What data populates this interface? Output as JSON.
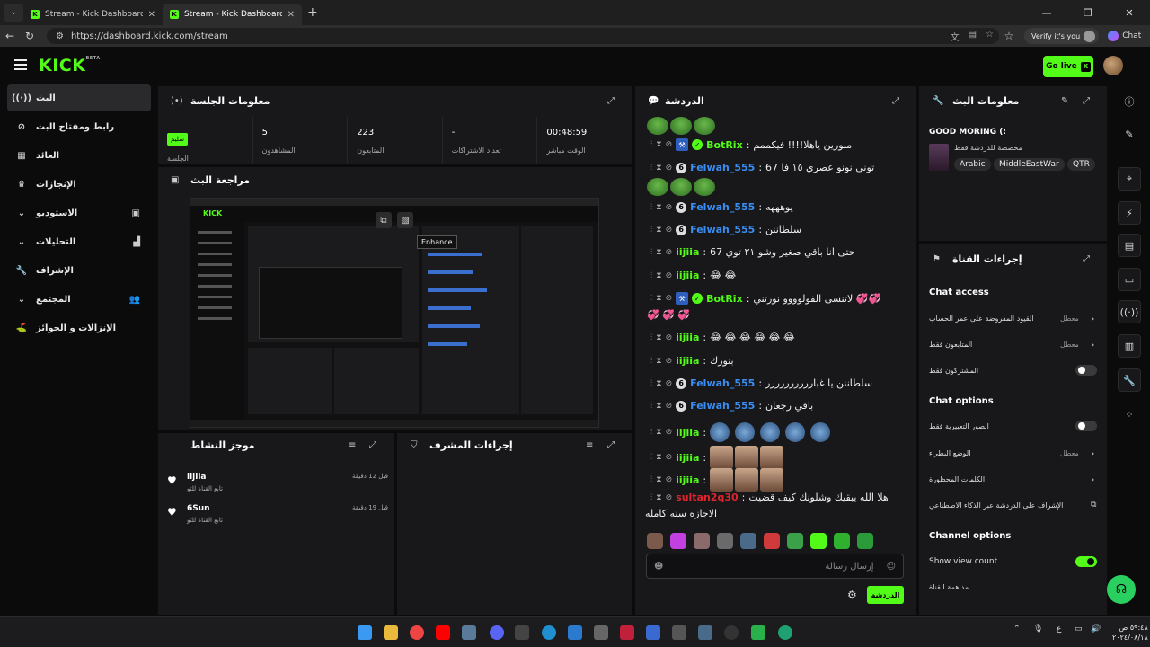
{
  "browser": {
    "tabs": [
      {
        "title": "Stream - Kick Dashboard"
      },
      {
        "title": "Stream - Kick Dashboard"
      }
    ],
    "url": "https://dashboard.kick.com/stream",
    "verify_label": "Verify it's you",
    "chat_label": "Chat"
  },
  "header": {
    "logo": "KICK",
    "logo_sup": "BETA",
    "go_live": "Go live"
  },
  "sidebar": {
    "items": [
      {
        "label": "البث",
        "icon": "broadcast-icon"
      },
      {
        "label": "رابط ومفتاح البث",
        "icon": "link-icon"
      },
      {
        "label": "العائد",
        "icon": "revenue-icon"
      },
      {
        "label": "الإنجازات",
        "icon": "trophy-icon"
      },
      {
        "label": "الاستوديو",
        "icon": "studio-icon"
      },
      {
        "label": "التحليلات",
        "icon": "analytics-icon"
      },
      {
        "label": "الإشراف",
        "icon": "wrench-icon"
      },
      {
        "label": "المجتمع",
        "icon": "community-icon"
      },
      {
        "label": "الإنزالات و الجوائز",
        "icon": "drops-icon"
      }
    ]
  },
  "session": {
    "title": "معلومات الجلسة",
    "badge": "سليم",
    "cells": [
      {
        "label": "الجلسة",
        "value": ""
      },
      {
        "label": "المشاهدون",
        "value": "5"
      },
      {
        "label": "المتابعون",
        "value": "223"
      },
      {
        "label": "تعداد الاشتراكات",
        "value": "-"
      },
      {
        "label": "الوقت مباشر",
        "value": "00:48:59"
      }
    ]
  },
  "preview": {
    "title": "مراجعة البث",
    "tooltip": "Enhance"
  },
  "activity": {
    "title": "موجز النشاط",
    "items": [
      {
        "name": "iijiia",
        "desc": "تابع القناة للتو",
        "time": "قبل 12 دقيقة"
      },
      {
        "name": "6Sun",
        "desc": "تابع القناة للتو",
        "time": "قبل 19 دقيقة"
      }
    ]
  },
  "moderator": {
    "title": "إجراءات المشرف"
  },
  "chat": {
    "title": "الدردشة",
    "messages": [
      {
        "user": "BotRix",
        "color": "#53fc18",
        "badge": "bot",
        "text": "منورين ياهلا!!!! فيكممم"
      },
      {
        "user": "Felwah_555",
        "color": "#3a8df2",
        "badge": "6",
        "text": "توني نونو عصري ١٥ فا 67"
      },
      {
        "user": "Felwah_555",
        "color": "#3a8df2",
        "badge": "6",
        "text": "يوهههه"
      },
      {
        "user": "Felwah_555",
        "color": "#3a8df2",
        "badge": "6",
        "text": "سلطاننن"
      },
      {
        "user": "iijiia",
        "color": "#53fc18",
        "badge": "",
        "text": "حتى انا باقي صغير وشو ٢١ توي 67"
      },
      {
        "user": "iijiia",
        "color": "#53fc18",
        "badge": "",
        "text": "😂 😂"
      },
      {
        "user": "BotRix",
        "color": "#53fc18",
        "badge": "bot",
        "text": "لاتنسى الفولوووو نورتني 💞💞"
      },
      {
        "user": "iijiia",
        "color": "#53fc18",
        "badge": "",
        "text": "😂 😂 😂 😂 😂 😂"
      },
      {
        "user": "iijiia",
        "color": "#53fc18",
        "badge": "",
        "text": "بنورك"
      },
      {
        "user": "Felwah_555",
        "color": "#3a8df2",
        "badge": "6",
        "text": "سلطاننن يا غبارررررررررر"
      },
      {
        "user": "Felwah_555",
        "color": "#3a8df2",
        "badge": "6",
        "text": "باقي رجعان"
      },
      {
        "user": "iijiia",
        "color": "#53fc18",
        "badge": "",
        "text": ""
      },
      {
        "user": "iijiia",
        "color": "#53fc18",
        "badge": "",
        "text": ""
      },
      {
        "user": "iijiia",
        "color": "#53fc18",
        "badge": "",
        "text": ""
      },
      {
        "user": "sultan2q30",
        "color": "#e0242c",
        "badge": "",
        "text": "هلا الله يبقيك وشلونك كيف قضيت"
      }
    ],
    "continuation": "الاجازه سنه كامله",
    "input_placeholder": "إرسال رسالة",
    "send_label": "الدردشة"
  },
  "stream_info": {
    "title": "معلومات البث",
    "stream_title": "GOOD MORING (:",
    "category": "مخصصة للدردشة فقط",
    "tags": [
      "Arabic",
      "MiddleEastWar",
      "QTR"
    ]
  },
  "channel_actions": {
    "title": "إجراءات القناة",
    "chat_access": {
      "heading": "Chat access",
      "rows": [
        {
          "label": "القيود المفروضة على عمر الحساب",
          "value": "معطل",
          "type": "chevron"
        },
        {
          "label": "المتابعون فقط",
          "value": "معطل",
          "type": "chevron"
        },
        {
          "label": "المشتركون فقط",
          "value": "",
          "type": "toggle",
          "on": false
        }
      ]
    },
    "chat_options": {
      "heading": "Chat options",
      "rows": [
        {
          "label": "الصور التعبيرية فقط",
          "value": "",
          "type": "toggle",
          "on": false
        },
        {
          "label": "الوضع البطيء",
          "value": "معطل",
          "type": "chevron"
        },
        {
          "label": "الكلمات المحظورة",
          "value": "",
          "type": "chevron"
        },
        {
          "label": "الإشراف على الدردشة عبر الذكاء الاصطناعي",
          "value": "",
          "type": "external"
        }
      ]
    },
    "channel_options": {
      "heading": "Channel options",
      "rows": [
        {
          "label": "Show view count",
          "value": "",
          "type": "toggle",
          "on": true
        },
        {
          "label": "مداهمة القناة",
          "value": "",
          "type": "none"
        }
      ]
    }
  },
  "taskbar": {
    "clock_time": "٥٩:٤٨ ص",
    "clock_date": "٢٠٢٤/٠٨/١٨",
    "lang": "ع"
  },
  "colors": {
    "accent": "#53fc18",
    "panel": "#18181a",
    "background": "#0b0b0c"
  }
}
